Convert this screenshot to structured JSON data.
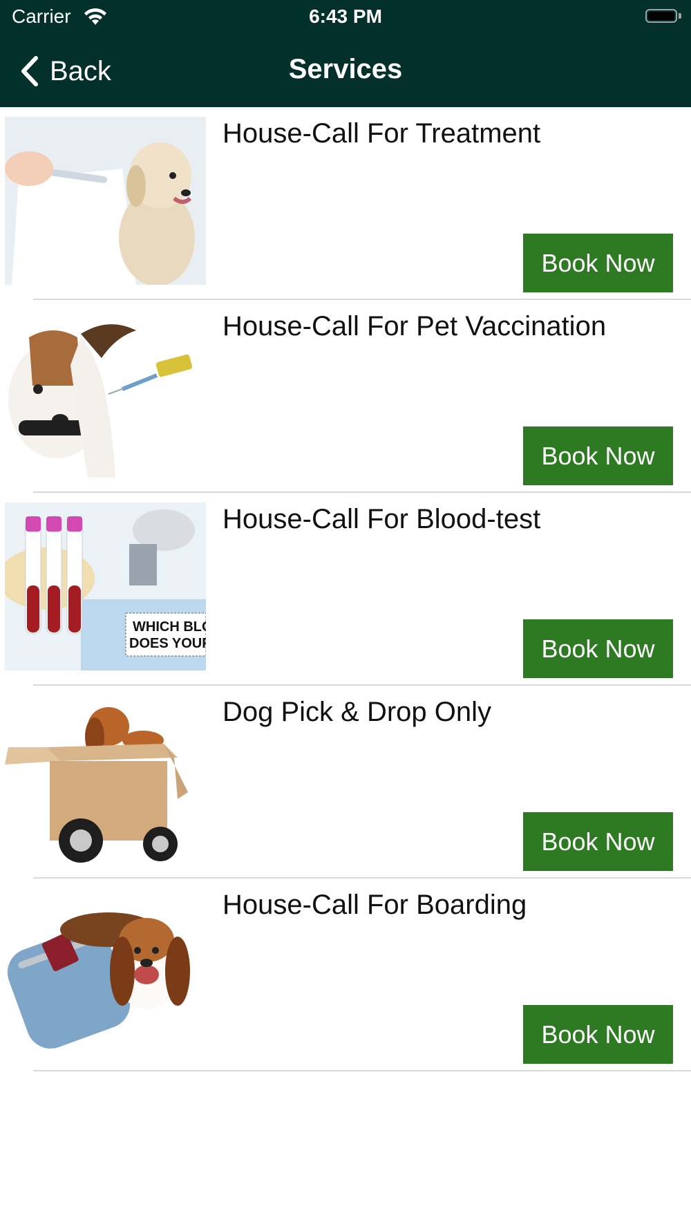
{
  "status_bar": {
    "carrier": "Carrier",
    "time": "6:43 PM"
  },
  "nav": {
    "back_label": "Back",
    "title": "Services"
  },
  "services": [
    {
      "title": "House-Call For Treatment",
      "button": "Book Now"
    },
    {
      "title": "House-Call For Pet Vaccination",
      "button": "Book Now"
    },
    {
      "title": "House-Call For Blood-test",
      "button": "Book Now",
      "image_text": [
        "WHICH BLOO",
        "DOES YOUR D"
      ]
    },
    {
      "title": "Dog Pick & Drop Only",
      "button": "Book Now"
    },
    {
      "title": "House-Call For Boarding",
      "button": "Book Now"
    }
  ],
  "colors": {
    "header": "#03302b",
    "button": "#2e7a22",
    "divider": "#d9d9d9"
  }
}
